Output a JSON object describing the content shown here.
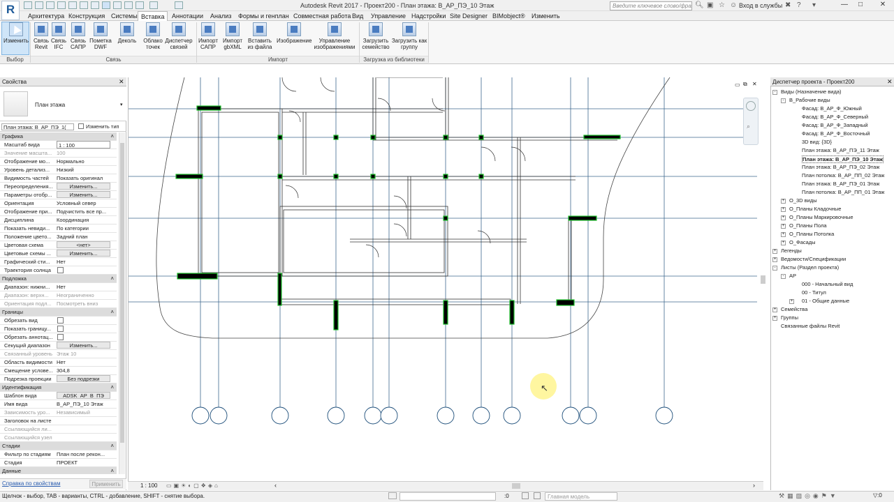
{
  "window": {
    "title": "Autodesk Revit 2017 -     Проект200 - План этажа: В_АР_ПЭ_10 Этаж",
    "app_logo": "R",
    "search_placeholder": "Введите ключевое слово/фразу",
    "login": "Вход в службы"
  },
  "tabs": [
    "Архитектура",
    "Конструкция",
    "Системы",
    "Вставка",
    "Аннотации",
    "Анализ",
    "Формы и генплан",
    "Совместная работа",
    "Вид",
    "Управление",
    "Надстройки",
    "Site Designer",
    "BIMobject®",
    "Изменить"
  ],
  "active_tab": "Вставка",
  "ribbon": {
    "buttons": [
      {
        "label": "Изменить"
      },
      {
        "label": "Связь Revit"
      },
      {
        "label": "Связь IFC"
      },
      {
        "label": "Связь САПР"
      },
      {
        "label": "Пометка DWF"
      },
      {
        "label": "Деколь"
      },
      {
        "label": "Облако точек"
      },
      {
        "label": "Диспетчер связей"
      },
      {
        "label": "Импорт САПР"
      },
      {
        "label": "Импорт gbXML"
      },
      {
        "label": "Вставить из файла"
      },
      {
        "label": "Изображение"
      },
      {
        "label": "Управление изображениями"
      },
      {
        "label": "Загрузить семейство"
      },
      {
        "label": "Загрузить как группу"
      }
    ],
    "groups": [
      "Выбор",
      "Связь",
      "Импорт",
      "Загрузка из библиотеки"
    ]
  },
  "properties": {
    "title": "Свойства",
    "type_name": "План этажа",
    "view_selector": "План этажа: В_АР_ПЭ_1(",
    "edit_type": "Изменить тип",
    "rows": [
      {
        "cat": "Графика"
      },
      {
        "k": "Масштаб вида",
        "v": "1 : 100",
        "inp": true
      },
      {
        "k": "Значение масшта...",
        "v": "100",
        "dis": true
      },
      {
        "k": "Отображение мо...",
        "v": "Нормально"
      },
      {
        "k": "Уровень детализ...",
        "v": "Низкий"
      },
      {
        "k": "Видимость частей",
        "v": "Показать оригинал"
      },
      {
        "k": "Переопределения...",
        "v": "Изменить...",
        "btn": true
      },
      {
        "k": "Параметры отобр...",
        "v": "Изменить...",
        "btn": true
      },
      {
        "k": "Ориентация",
        "v": "Условный север"
      },
      {
        "k": "Отображение при...",
        "v": "Подчистить все пр..."
      },
      {
        "k": "Дисциплина",
        "v": "Координация"
      },
      {
        "k": "Показать невиди...",
        "v": "По категории"
      },
      {
        "k": "Положение цвето...",
        "v": "Задний план"
      },
      {
        "k": "Цветовая схема",
        "v": "<нет>",
        "btn": true
      },
      {
        "k": "Цветовые схемы ...",
        "v": "Изменить...",
        "btn": true
      },
      {
        "k": "Графический сти...",
        "v": "Нет"
      },
      {
        "k": "Траектория солнца",
        "chk": true
      },
      {
        "cat": "Подложка"
      },
      {
        "k": "Диапазон: нижни...",
        "v": "Нет"
      },
      {
        "k": "Диапазон: верхн...",
        "v": "Неограниченно",
        "dis": true
      },
      {
        "k": "Ориентация подл...",
        "v": "Посмотреть вниз",
        "dis": true
      },
      {
        "cat": "Границы"
      },
      {
        "k": "Обрезать вид",
        "chk": true
      },
      {
        "k": "Показать границу...",
        "chk": true
      },
      {
        "k": "Обрезать аннотац...",
        "chk": true
      },
      {
        "k": "Секущий диапазон",
        "v": "Изменить...",
        "btn": true
      },
      {
        "k": "Связанный уровень",
        "v": "Этаж 10",
        "dis": true
      },
      {
        "k": "Область видимости",
        "v": "Нет"
      },
      {
        "k": "Смещение услове...",
        "v": "304,8"
      },
      {
        "k": "Подрезка проекции",
        "v": "Без подрезки",
        "btn": true
      },
      {
        "cat": "Идентификация"
      },
      {
        "k": "Шаблон вида",
        "v": "ADSK_АР_В_ПЭ",
        "btn": true
      },
      {
        "k": "Имя вида",
        "v": "В_АР_ПЭ_10 Этаж"
      },
      {
        "k": "Зависимость уро...",
        "v": "Независимый",
        "dis": true
      },
      {
        "k": "Заголовок на листе",
        "v": ""
      },
      {
        "k": "Ссылающийся ли...",
        "v": "",
        "dis": true
      },
      {
        "k": "Ссылающийся узел",
        "v": "",
        "dis": true
      },
      {
        "cat": "Стадии"
      },
      {
        "k": "Фильтр по стадиям",
        "v": "План после рекон..."
      },
      {
        "k": "Стадия",
        "v": "ПРОЕКТ"
      },
      {
        "cat": "Данные"
      }
    ],
    "help_link": "Справка по свойствам",
    "apply": "Применить"
  },
  "view_control": {
    "scale": "1 : 100"
  },
  "browser": {
    "title": "Диспетчер проекта - Проект200",
    "items": [
      {
        "label": "Виды (Назначение вида)",
        "lvl": 0,
        "tg": "-"
      },
      {
        "label": "В_Рабочие виды",
        "lvl": 1,
        "tg": "-"
      },
      {
        "label": "Фасад: В_АР_Ф_Южный",
        "lvl": 2
      },
      {
        "label": "Фасад: В_АР_Ф_Северный",
        "lvl": 2
      },
      {
        "label": "Фасад: В_АР_Ф_Западный",
        "lvl": 2
      },
      {
        "label": "Фасад: В_АР_Ф_Восточный",
        "lvl": 2
      },
      {
        "label": "3D вид: {3D}",
        "lvl": 2
      },
      {
        "label": "План этажа: В_АР_ПЭ_11 Этаж",
        "lvl": 2
      },
      {
        "label": "План этажа: В_АР_ПЭ_10 Этаж",
        "lvl": 2,
        "sel": true
      },
      {
        "label": "План этажа: В_АР_ПЭ_02 Этаж",
        "lvl": 2
      },
      {
        "label": "План потолка: В_АР_ПП_02 Этаж",
        "lvl": 2
      },
      {
        "label": "План этажа: В_АР_ПЭ_01 Этаж",
        "lvl": 2
      },
      {
        "label": "План потолка: В_АР_ПП_01 Этаж",
        "lvl": 2
      },
      {
        "label": "О_3D виды",
        "lvl": 1,
        "tg": "+"
      },
      {
        "label": "О_Планы Кладочные",
        "lvl": 1,
        "tg": "+"
      },
      {
        "label": "О_Планы Маркировочные",
        "lvl": 1,
        "tg": "+"
      },
      {
        "label": "О_Планы Пола",
        "lvl": 1,
        "tg": "+"
      },
      {
        "label": "О_Планы Потолка",
        "lvl": 1,
        "tg": "+"
      },
      {
        "label": "О_Фасады",
        "lvl": 1,
        "tg": "+"
      },
      {
        "label": "Легенды",
        "lvl": 0,
        "tg": "+"
      },
      {
        "label": "Ведомости/Спецификации",
        "lvl": 0,
        "tg": "+"
      },
      {
        "label": "Листы (Раздел проекта)",
        "lvl": 0,
        "tg": "-"
      },
      {
        "label": "АР",
        "lvl": 1,
        "tg": "-"
      },
      {
        "label": "000 - Начальный вид",
        "lvl": 2
      },
      {
        "label": "00 - Титул",
        "lvl": 2
      },
      {
        "label": "01 - Общие данные",
        "lvl": 2,
        "tg": "+"
      },
      {
        "label": "Семейства",
        "lvl": 0,
        "tg": "+"
      },
      {
        "label": "Группы",
        "lvl": 0,
        "tg": "+"
      },
      {
        "label": "Связанные файлы Revit",
        "lvl": 0
      }
    ]
  },
  "status": {
    "hint": "Щелчок - выбор, TAB - варианты, CTRL - добавление, SHIFT - снятие выбора.",
    "zero": ":0",
    "model": "Главная модель"
  }
}
